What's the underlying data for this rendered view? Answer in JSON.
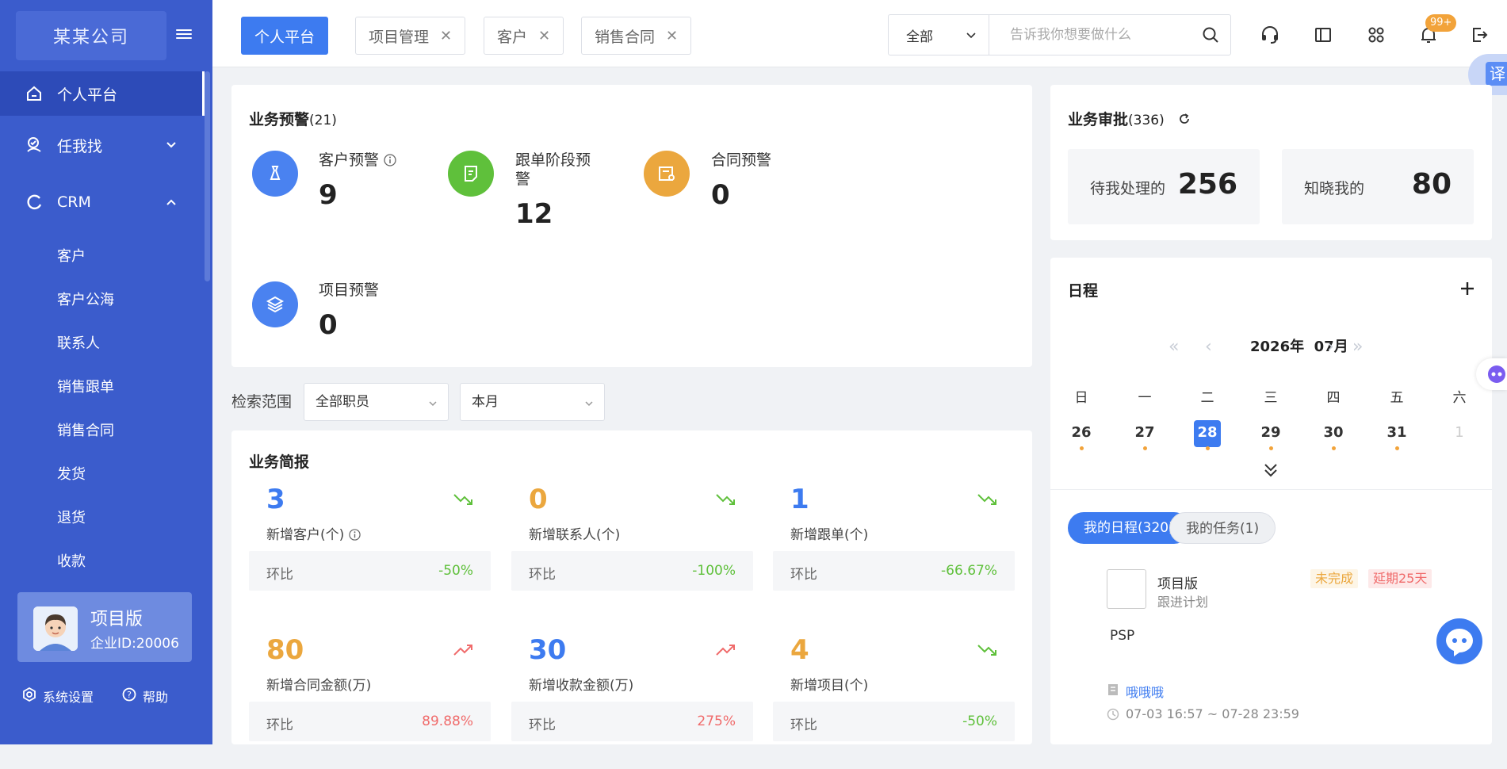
{
  "sidebar": {
    "logo": "某某公司",
    "items": [
      {
        "label": "个人平台",
        "icon": "home-icon"
      },
      {
        "label": "任我找",
        "icon": "search-person-icon"
      },
      {
        "label": "CRM",
        "icon": "circle-icon"
      }
    ],
    "crm_sub": [
      "客户",
      "客户公海",
      "联系人",
      "销售跟单",
      "销售合同",
      "发货",
      "退货",
      "收款"
    ],
    "user": {
      "name": "项目版",
      "id": "企业ID:20006"
    },
    "settings": "系统设置",
    "help": "帮助"
  },
  "tabs": [
    {
      "label": "个人平台"
    },
    {
      "label": "项目管理"
    },
    {
      "label": "客户"
    },
    {
      "label": "销售合同"
    }
  ],
  "search": {
    "scope": "全部",
    "placeholder": "告诉我你想要做什么"
  },
  "notify_badge": "99+",
  "translate": "译",
  "alerts": {
    "title": "业务预警",
    "count": "(21)",
    "items": [
      {
        "label": "客户预警",
        "value": "9",
        "color": "#4a82f0"
      },
      {
        "label": "跟单阶段预警",
        "value": "12",
        "color": "#5fc03b"
      },
      {
        "label": "合同预警",
        "value": "0",
        "color": "#eba73e"
      },
      {
        "label": "项目预警",
        "value": "0",
        "color": "#4a82f0"
      }
    ]
  },
  "approval": {
    "title": "业务审批",
    "count": "(336)",
    "pending_label": "待我处理的",
    "pending_value": "256",
    "known_label": "知晓我的",
    "known_value": "80"
  },
  "filter": {
    "label": "检索范围",
    "staff": "全部职员",
    "period": "本月"
  },
  "summary": {
    "title": "业务简报",
    "compare_label": "环比",
    "stats": [
      {
        "value": "3",
        "label": "新增客户(个)",
        "change": "-50%",
        "value_color": "#3d7bf0",
        "trend": "down"
      },
      {
        "value": "0",
        "label": "新增联系人(个)",
        "change": "-100%",
        "value_color": "#eba73e",
        "trend": "down"
      },
      {
        "value": "1",
        "label": "新增跟单(个)",
        "change": "-66.67%",
        "value_color": "#3d7bf0",
        "trend": "down"
      },
      {
        "value": "80",
        "label": "新增合同金额(万)",
        "change": "89.88%",
        "value_color": "#eba73e",
        "trend": "up"
      },
      {
        "value": "30",
        "label": "新增收款金额(万)",
        "change": "275%",
        "value_color": "#3d7bf0",
        "trend": "up"
      },
      {
        "value": "4",
        "label": "新增项目(个)",
        "change": "-50%",
        "value_color": "#eba73e",
        "trend": "down"
      }
    ]
  },
  "schedule": {
    "title": "日程",
    "year": "2026年",
    "month": "07月",
    "weekdays": [
      "日",
      "一",
      "二",
      "三",
      "四",
      "五",
      "六"
    ],
    "days": [
      "26",
      "27",
      "28",
      "29",
      "30",
      "31",
      "1"
    ],
    "tab_mine": "我的日程(320)",
    "tab_tasks": "我的任务(1)",
    "entry": {
      "title": "项目版",
      "subtitle": "跟进计划",
      "status": "未完成",
      "overdue": "延期25天",
      "note": "PSP",
      "owner": "哦哦哦",
      "time": "07-03 16:57 ~ 07-28 23:59"
    }
  }
}
